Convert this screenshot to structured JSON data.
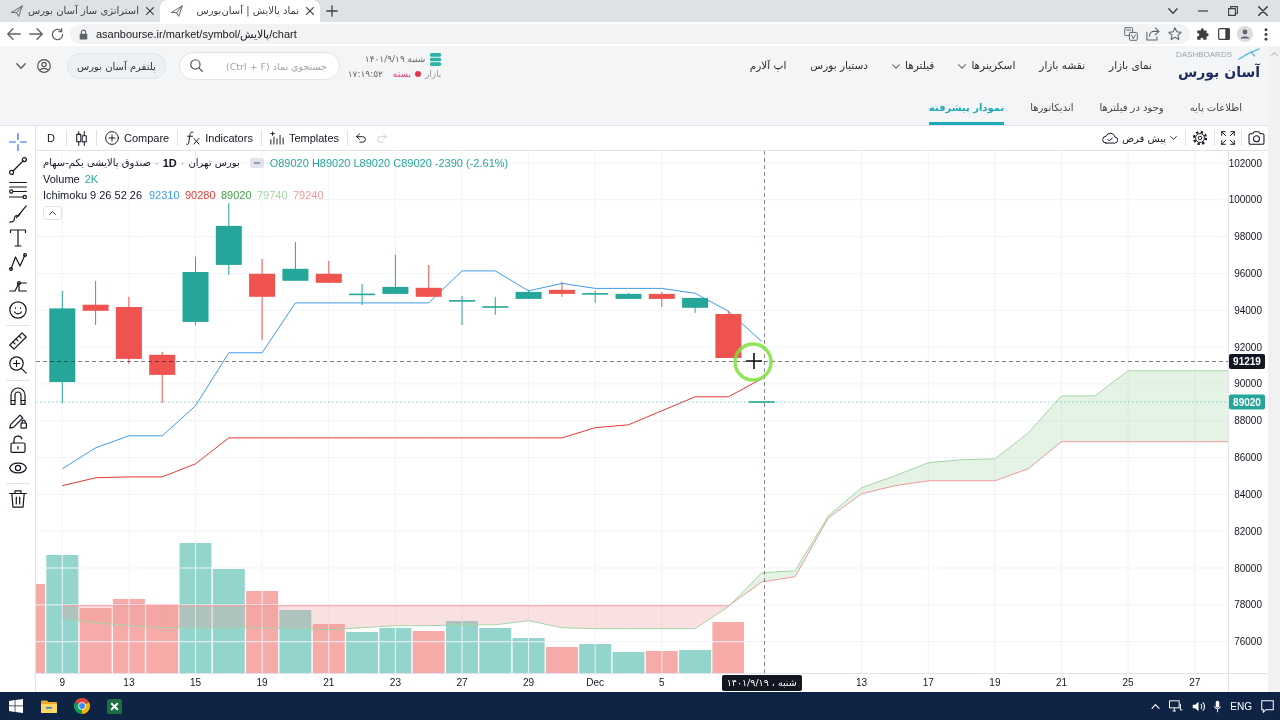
{
  "browser": {
    "tabs": [
      {
        "title": "نماد پالایش | آسان‌بورس",
        "selected": true
      },
      {
        "title": "استراتژی ساز آسان بورس",
        "selected": false
      }
    ],
    "url": "asanbourse.ir/market/symbol/پالایش/chart"
  },
  "header": {
    "logo": {
      "text": "آسان بورس",
      "subtext": "DASHBOARDS"
    },
    "nav": [
      {
        "label": "نمای بازار",
        "dropdown": false
      },
      {
        "label": "نقشه بازار",
        "dropdown": false
      },
      {
        "label": "اسکرینرها",
        "dropdown": true
      },
      {
        "label": "فیلترها",
        "dropdown": true
      },
      {
        "label": "دستیار بورس",
        "dropdown": false
      },
      {
        "label": "اپ آلارم",
        "dropdown": false
      }
    ],
    "market": {
      "date": "شنبه ۱۴۰۱/۹/۱۹",
      "label": "بازار",
      "open": false,
      "state": "بسته",
      "time": "۱۷:۱۹:۵۲"
    },
    "search": {
      "placeholder": "جستجوی نماد (Ctrl + F)"
    },
    "platform_button": "پلتفرم آسان بورس"
  },
  "sub_tabs": [
    {
      "label": "اطلاعات پایه",
      "selected": false
    },
    {
      "label": "وجود در فیلترها",
      "selected": false
    },
    {
      "label": "اندیکاتورها",
      "selected": false
    },
    {
      "label": "نمودار پیشرفته",
      "selected": true
    }
  ],
  "drawing_tools": [
    [
      {
        "kind": "crosshair",
        "selected": true
      },
      {
        "kind": "trend_line",
        "selected": false
      },
      {
        "kind": "fib",
        "selected": false
      },
      {
        "kind": "brush",
        "selected": false
      },
      {
        "kind": "text",
        "selected": false
      },
      {
        "kind": "pattern",
        "selected": false
      },
      {
        "kind": "forecast",
        "selected": false
      },
      {
        "kind": "emoji",
        "selected": false
      }
    ],
    [
      {
        "kind": "ruler",
        "selected": false
      },
      {
        "kind": "zoom",
        "selected": false
      }
    ],
    [
      {
        "kind": "magnet",
        "selected": false
      },
      {
        "kind": "draw_mode",
        "selected": false
      },
      {
        "kind": "lock",
        "selected": false
      },
      {
        "kind": "visibility",
        "selected": false
      }
    ],
    [
      {
        "kind": "remove",
        "selected": false
      }
    ]
  ],
  "chart_toolbar": {
    "interval": "D",
    "buttons": [
      {
        "kind": "templates",
        "label": "Templates"
      },
      {
        "kind": "indicators",
        "label": "Indicators"
      },
      {
        "kind": "compare",
        "label": "Compare"
      }
    ],
    "history": [
      {
        "kind": "undo",
        "disabled": false
      },
      {
        "kind": "redo",
        "disabled": true
      }
    ],
    "layout": "پیش فرض"
  },
  "legend": {
    "title": [
      {
        "kind": "exchange",
        "text": "بورس تهران"
      },
      {
        "kind": "separator",
        "text": "·"
      },
      {
        "kind": "interval",
        "text": "1D"
      },
      {
        "kind": "separator",
        "text": "·"
      },
      {
        "kind": "symbol",
        "text": "صندوق پالایشی یکم-سهام"
      }
    ],
    "ohlc": "O89020 H89020 L89020 C89020 -2390 (-2.61%)",
    "volume": {
      "label": "Volume",
      "value": "2K"
    },
    "indicator": {
      "label": "Ichimoku 9 26 52 26",
      "values": [
        {
          "text": "79240",
          "color": "#ef9a9a"
        },
        {
          "text": "79740",
          "color": "#a5d6a7"
        },
        {
          "text": "89020",
          "color": "#43a047"
        },
        {
          "text": "90280",
          "color": "#e53935"
        },
        {
          "text": "92310",
          "color": "#3d9bf0"
        }
      ]
    }
  },
  "chart_data": [
    {
      "type": "candlestick",
      "categories": [
        null,
        "9",
        null,
        "13",
        null,
        "15",
        null,
        "19",
        null,
        "21",
        null,
        "23",
        null,
        "27",
        null,
        "29",
        null,
        "Dec",
        null,
        "5",
        null,
        null,
        null,
        null,
        null,
        "13",
        null,
        "17",
        null,
        "19",
        null,
        "21",
        null,
        "25",
        null,
        "27",
        null
      ],
      "ylim": [
        74300,
        102650
      ],
      "yticks": [
        76000,
        78000,
        80000,
        82000,
        84000,
        86000,
        88000,
        90000,
        92000,
        94000,
        96000,
        98000,
        100000,
        102000
      ],
      "grid": true,
      "series": [
        {
          "type": "line",
          "color": "#a5d6a7",
          "values": [
            null,
            77250,
            77030,
            76870,
            76760,
            76760,
            76760,
            76760,
            76710,
            76650,
            76760,
            76870,
            76870,
            76920,
            76920,
            77140,
            76760,
            76710,
            76710,
            76710,
            76710,
            77900,
            79740,
            79850,
            82840,
            84360,
            85010,
            85720,
            85880,
            85930,
            87340,
            89350,
            89350,
            90710,
            90710,
            90710,
            90710
          ]
        },
        {
          "type": "line",
          "color": "#ef9a9a",
          "values": [
            null,
            77950,
            77950,
            77950,
            77950,
            77950,
            77950,
            77950,
            77950,
            77950,
            77950,
            77950,
            77950,
            77950,
            77950,
            77950,
            77950,
            77950,
            77950,
            77950,
            77950,
            77950,
            79240,
            79530,
            82730,
            84030,
            84470,
            84740,
            84740,
            84740,
            85390,
            86860,
            86860,
            86860,
            86860,
            86860,
            86860
          ]
        },
        {
          "type": "line",
          "color": "#3d9bf0",
          "values": [
            null,
            85390,
            86530,
            87180,
            87180,
            88810,
            91690,
            91690,
            94400,
            94400,
            94400,
            94400,
            94400,
            96140,
            96140,
            95050,
            95460,
            95190,
            95190,
            95190,
            94920,
            93950,
            92310,
            null,
            null,
            null,
            null,
            null,
            null,
            null,
            null,
            null,
            null,
            null,
            null,
            null,
            null
          ]
        },
        {
          "type": "line",
          "color": "#e53935",
          "values": [
            null,
            84470,
            84900,
            84950,
            84950,
            85660,
            87070,
            87070,
            87070,
            87070,
            87070,
            87070,
            87070,
            87070,
            87070,
            87070,
            87070,
            87620,
            87780,
            88540,
            89300,
            89300,
            90280,
            null,
            null,
            null,
            null,
            null,
            null,
            null,
            null,
            null,
            null,
            null,
            null,
            null,
            null
          ]
        },
        {
          "type": "candlestick",
          "ohlc": [
            null,
            [
              90100,
              95050,
              88970,
              94100
            ],
            [
              94300,
              95600,
              93200,
              93970
            ],
            [
              94180,
              94730,
              91090,
              91360
            ],
            [
              91580,
              91740,
              88970,
              90490
            ],
            [
              93370,
              96900,
              93200,
              96080
            ],
            [
              96460,
              99830,
              95920,
              98580
            ],
            [
              95980,
              96790,
              92390,
              94730
            ],
            [
              95600,
              97710,
              95600,
              96250
            ],
            [
              95980,
              96680,
              95490,
              95490
            ],
            [
              94860,
              95430,
              94290,
              94860
            ],
            [
              94890,
              97010,
              94890,
              95270
            ],
            [
              95220,
              96460,
              94730,
              94730
            ],
            [
              94510,
              94780,
              93200,
              94510
            ],
            [
              94180,
              94730,
              93750,
              94180
            ],
            [
              94620,
              95110,
              94620,
              95000
            ],
            [
              95110,
              95540,
              94730,
              94890
            ],
            [
              94890,
              95050,
              94400,
              94890
            ],
            [
              94620,
              94940,
              94620,
              94890
            ],
            [
              94890,
              95000,
              94180,
              94620
            ],
            [
              94130,
              94670,
              93860,
              94670
            ],
            [
              93800,
              93970,
              91410,
              91410
            ],
            [
              89020,
              89020,
              89020,
              89020
            ],
            null,
            null,
            null,
            null,
            null,
            null,
            null,
            null,
            null,
            null,
            null,
            null,
            null,
            null
          ],
          "colors": [
            null,
            "#26a69a",
            "#ef5350",
            "#ef5350",
            "#ef5350",
            "#26a69a",
            "#26a69a",
            "#ef5350",
            "#26a69a",
            "#ef5350",
            "#26a69a",
            "#26a69a",
            "#ef5350",
            "#26a69a",
            "#26a69a",
            "#26a69a",
            "#ef5350",
            "#26a69a",
            "#26a69a",
            "#ef5350",
            "#26a69a",
            "#ef5350",
            "#26a69a",
            null,
            null,
            null,
            null,
            null,
            null,
            null,
            null,
            null,
            null,
            null,
            null,
            null,
            null
          ]
        }
      ],
      "ref_lines": [
        {
          "axis": "y",
          "value": 91219,
          "label": "91219",
          "color": "#131722",
          "line_style": "dashed"
        },
        {
          "axis": "y",
          "value": 89020,
          "label": "89020",
          "color": "#26a69a",
          "line_style": "dotted"
        }
      ]
    }
  ],
  "crosshair": {
    "date_label": "شنبه ، ۱۴۰۱/۹/۱۹"
  },
  "taskbar": {
    "language": "ENG"
  }
}
